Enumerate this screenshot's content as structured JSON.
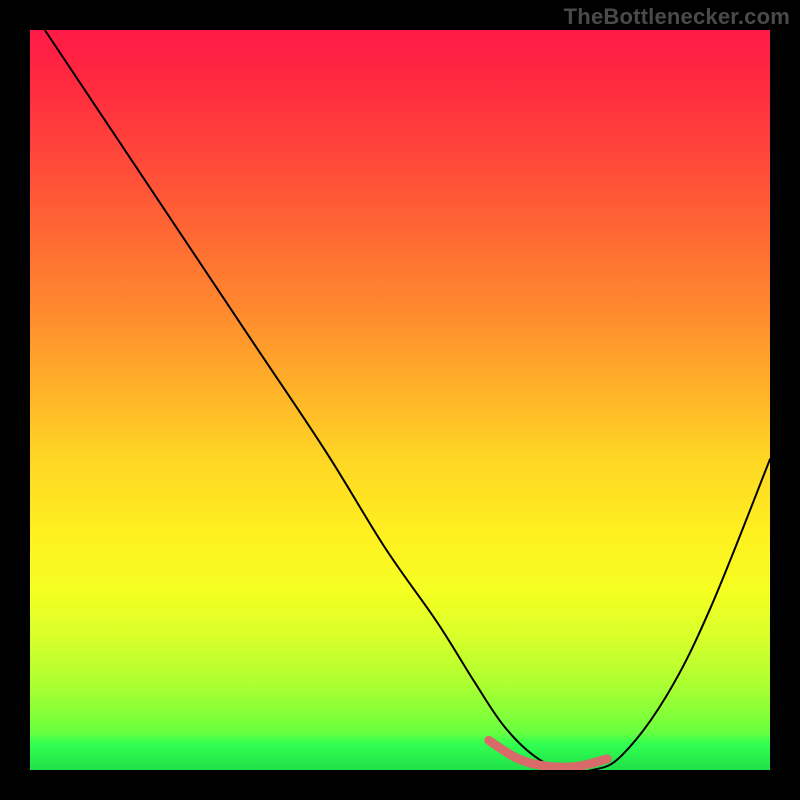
{
  "watermark": "TheBottleneckеr.com",
  "chart_data": {
    "type": "line",
    "title": "",
    "xlabel": "",
    "ylabel": "",
    "xlim": [
      0,
      100
    ],
    "ylim": [
      0,
      100
    ],
    "series": [
      {
        "name": "bottleneck-curve",
        "x": [
          2,
          10,
          20,
          30,
          40,
          48,
          55,
          60,
          64,
          68,
          72,
          76,
          80,
          86,
          92,
          100
        ],
        "y": [
          100,
          88,
          73,
          58,
          43,
          30,
          20,
          12,
          6,
          2,
          0,
          0,
          2,
          10,
          22,
          42
        ]
      },
      {
        "name": "optimal-marker",
        "x": [
          62,
          66,
          70,
          74,
          78
        ],
        "y": [
          4,
          1.5,
          0.5,
          0.5,
          1.5
        ]
      }
    ],
    "background_gradient": {
      "top": "#ff1a47",
      "mid": "#ffd624",
      "bottom": "#2aff52"
    }
  }
}
